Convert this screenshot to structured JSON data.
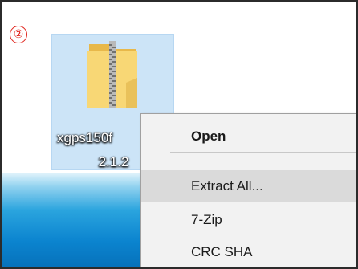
{
  "step_marker": "②",
  "desktop_icon": {
    "icon": "zip-folder-icon",
    "name_line1": "xgps150f",
    "name_line2": "2.1.2"
  },
  "context_menu": {
    "items": [
      {
        "label": "Open",
        "bold": true
      },
      {
        "label": "Extract All...",
        "highlighted": true
      },
      {
        "label": "7-Zip"
      },
      {
        "label": "CRC SHA"
      }
    ]
  },
  "colors": {
    "marker": "#e0231b",
    "selection": "#cce4f7",
    "menu_background": "#f2f2f2",
    "menu_highlight": "#dadada"
  }
}
